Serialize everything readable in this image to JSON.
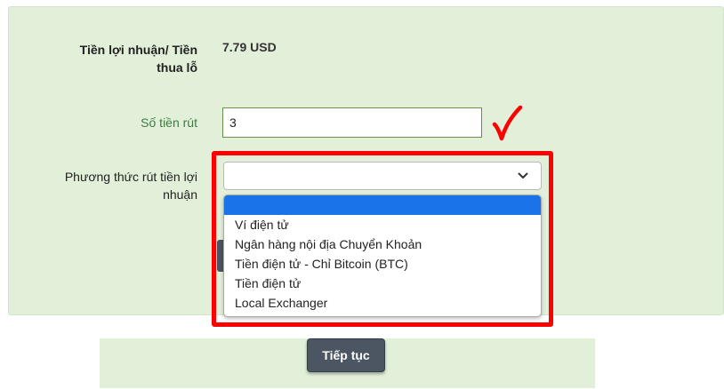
{
  "form": {
    "profit_label_line1": "Tiền lợi nhuận/ Tiền",
    "profit_label_line2": "thua lỗ",
    "profit_value": "7.79 USD",
    "amount_label": "Số tiền rút",
    "amount_value": "3",
    "method_label_line1": "Phương thức rút tiền lợi",
    "method_label_line2": "nhuận",
    "method_selected": "",
    "method_options": [
      "",
      "Ví điện tử",
      "Ngân hàng nội địa Chuyển Khoản",
      "Tiền điện tử - Chỉ Bitcoin (BTC)",
      "Tiền điện tử",
      "Local Exchanger"
    ]
  },
  "buttons": {
    "continue_label": "Tiếp tục"
  },
  "icons": {
    "check": "check-mark-icon",
    "chevron": "chevron-down-icon"
  },
  "colors": {
    "panel_bg": "#e2f0da",
    "highlight": "#ff0000",
    "check": "#ff0000",
    "selected_option": "#1a73e8",
    "button_bg": "#4b5662"
  }
}
